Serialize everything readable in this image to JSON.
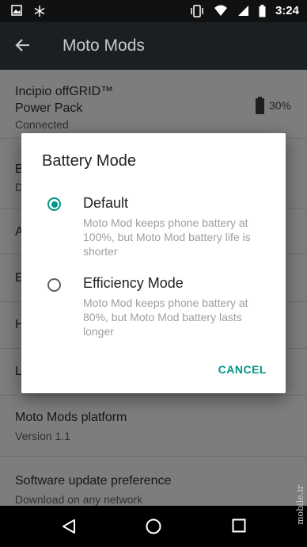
{
  "status_bar": {
    "time": "3:24",
    "left_icons": [
      "image-icon",
      "snowflake-icon"
    ],
    "right_icons": [
      "vibrate-icon",
      "wifi-icon",
      "signal-icon",
      "battery-icon"
    ]
  },
  "app_bar": {
    "title": "Moto Mods"
  },
  "list": {
    "power_pack": {
      "title": "Incipio offGRID™ Power Pack",
      "status": "Connected",
      "battery": "30%"
    },
    "hidden_rows": [
      "B",
      "D",
      "A",
      "E",
      "H",
      "L"
    ],
    "platform": {
      "title": "Moto Mods platform",
      "version": "Version 1.1"
    },
    "update": {
      "title": "Software update preference",
      "subtitle": "Download on any network"
    }
  },
  "dialog": {
    "title": "Battery Mode",
    "options": [
      {
        "label": "Default",
        "description": "Moto Mod keeps phone battery at 100%, but Moto Mod battery life is shorter",
        "selected": true
      },
      {
        "label": "Efficiency Mode",
        "description": "Moto Mod keeps phone battery at 80%, but Moto Mod battery lasts longer",
        "selected": false
      }
    ],
    "cancel_label": "CANCEL"
  },
  "nav_bar": {
    "icons": [
      "back-icon",
      "home-icon",
      "recents-icon"
    ]
  },
  "watermark": "mobile.ir",
  "colors": {
    "accent": "#009688",
    "status_bar": "#101112",
    "app_bar": "#1c1f21",
    "scrim": "#7d7d7d"
  }
}
